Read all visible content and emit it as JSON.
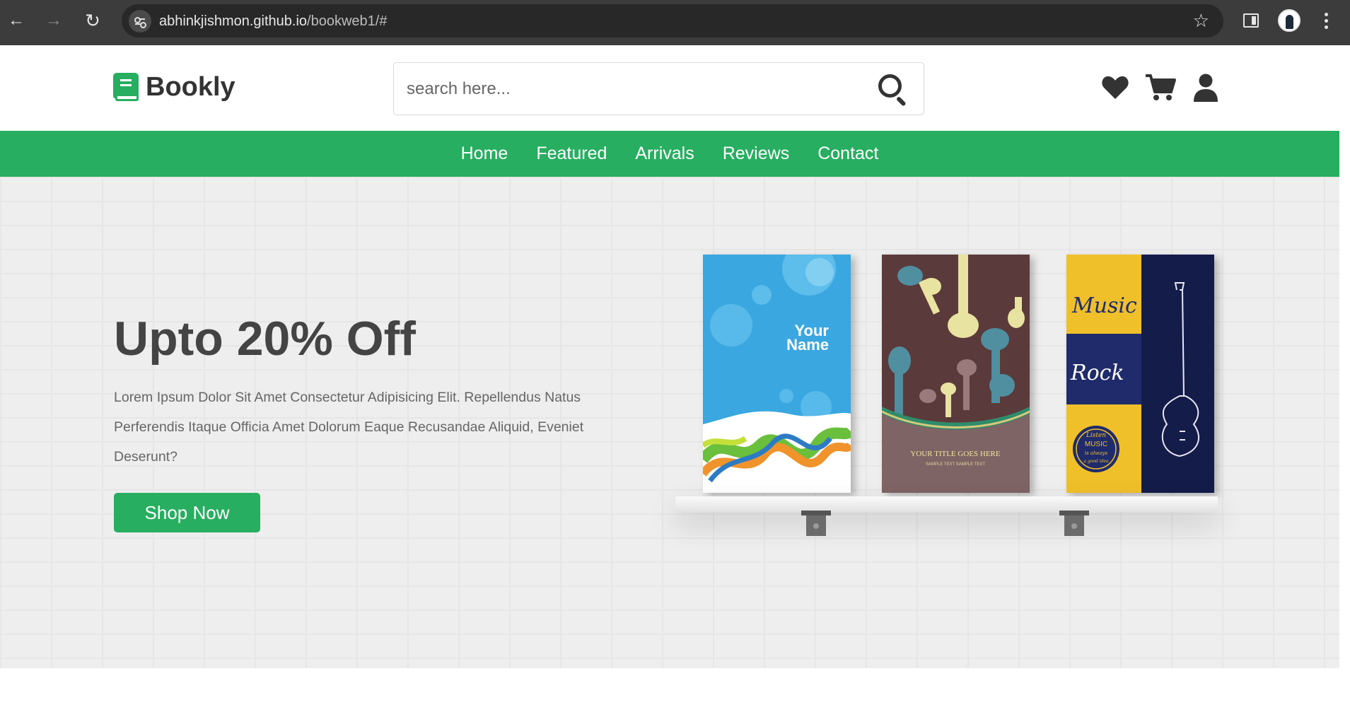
{
  "browser": {
    "url_host": "abhinkjishmon.github.io",
    "url_path": "/bookweb1/#"
  },
  "header": {
    "logo_text": "Bookly",
    "search_placeholder": "search here...",
    "search_value": ""
  },
  "nav": {
    "items": [
      "Home",
      "Featured",
      "Arrivals",
      "Reviews",
      "Contact"
    ]
  },
  "hero": {
    "title": "Upto 20% Off",
    "description": "Lorem Ipsum Dolor Sit Amet Consectetur Adipisicing Elit. Repellendus Natus Perferendis Itaque Officia Amet Dolorum Eaque Recusandae Aliquid, Eveniet Deserunt?",
    "cta_label": "Shop Now"
  },
  "books": {
    "book1": {
      "title_line1": "Your",
      "title_line2": "Name"
    },
    "book2": {
      "title": "YOUR TITLE GOES HERE",
      "subtitle": "SAMPLE TEXT SAMPLE TEXT"
    },
    "book3": {
      "word1": "Music",
      "word2": "Rock",
      "badge_line1": "Listen",
      "badge_line2": "MUSIC",
      "badge_line3": "is always",
      "badge_line4": "a good idea"
    }
  },
  "colors": {
    "accent": "#27ae60",
    "text_dark": "#333333",
    "chrome_bg": "#3c3c3c"
  },
  "icons": [
    "back-icon",
    "forward-icon",
    "reload-icon",
    "site-settings-icon",
    "bookmark-star-icon",
    "side-panel-icon",
    "profile-avatar",
    "menu-kebab-icon",
    "book-logo-icon",
    "search-icon",
    "heart-icon",
    "cart-icon",
    "user-icon"
  ]
}
